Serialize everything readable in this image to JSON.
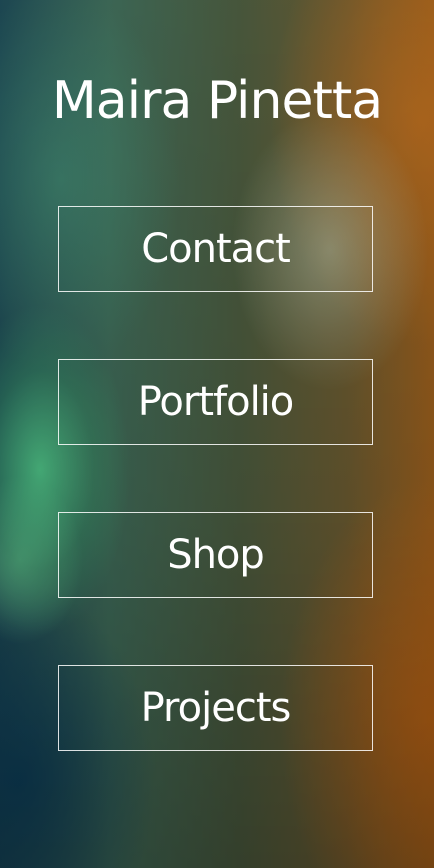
{
  "header": {
    "title": "Maira Pinetta"
  },
  "nav": {
    "items": [
      {
        "label": "Contact"
      },
      {
        "label": "Portfolio"
      },
      {
        "label": "Shop"
      },
      {
        "label": "Projects"
      }
    ]
  },
  "colors": {
    "text": "#ffffff",
    "button_border": "#ffffff"
  }
}
